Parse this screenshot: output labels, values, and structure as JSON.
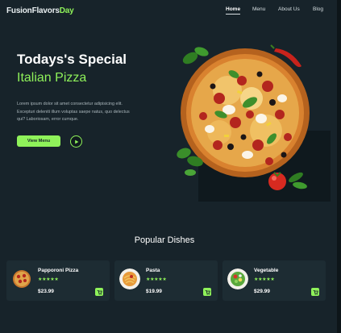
{
  "brand": {
    "name_part1": "FusionFlavors",
    "name_part2": "Day",
    "accent_color": "#8ff25a"
  },
  "nav": {
    "items": [
      "Home",
      "Menu",
      "About Us",
      "Blog"
    ],
    "active": "Home"
  },
  "hero": {
    "title": "Todays's Special",
    "subtitle": "Italian Pizza",
    "description": "Lorem ipsum dolor sit amet consectetur adipisicing elit. Excepturi deleniti illum voluptas saepe natus, quo delectus qui? Laboriosam, error cumque.",
    "menu_button": "View Menu",
    "play_icon": "play-icon",
    "image": "pizza-with-basil-tomato-chili"
  },
  "popular": {
    "title": "Popular Dishes",
    "items": [
      {
        "name": "Papporoni Pizza",
        "rating_stars": "★★★★★",
        "rating": 5,
        "price": "$23.99",
        "thumb": "pepperoni-pizza"
      },
      {
        "name": "Pasta",
        "rating_stars": "★★★★★",
        "rating": 5,
        "price": "$19.99",
        "thumb": "pasta-plate"
      },
      {
        "name": "Vegetable",
        "rating_stars": "★★★★★",
        "rating": 5,
        "price": "$29.99",
        "thumb": "vegetable-salad"
      }
    ],
    "cart_icon": "cart-icon"
  }
}
